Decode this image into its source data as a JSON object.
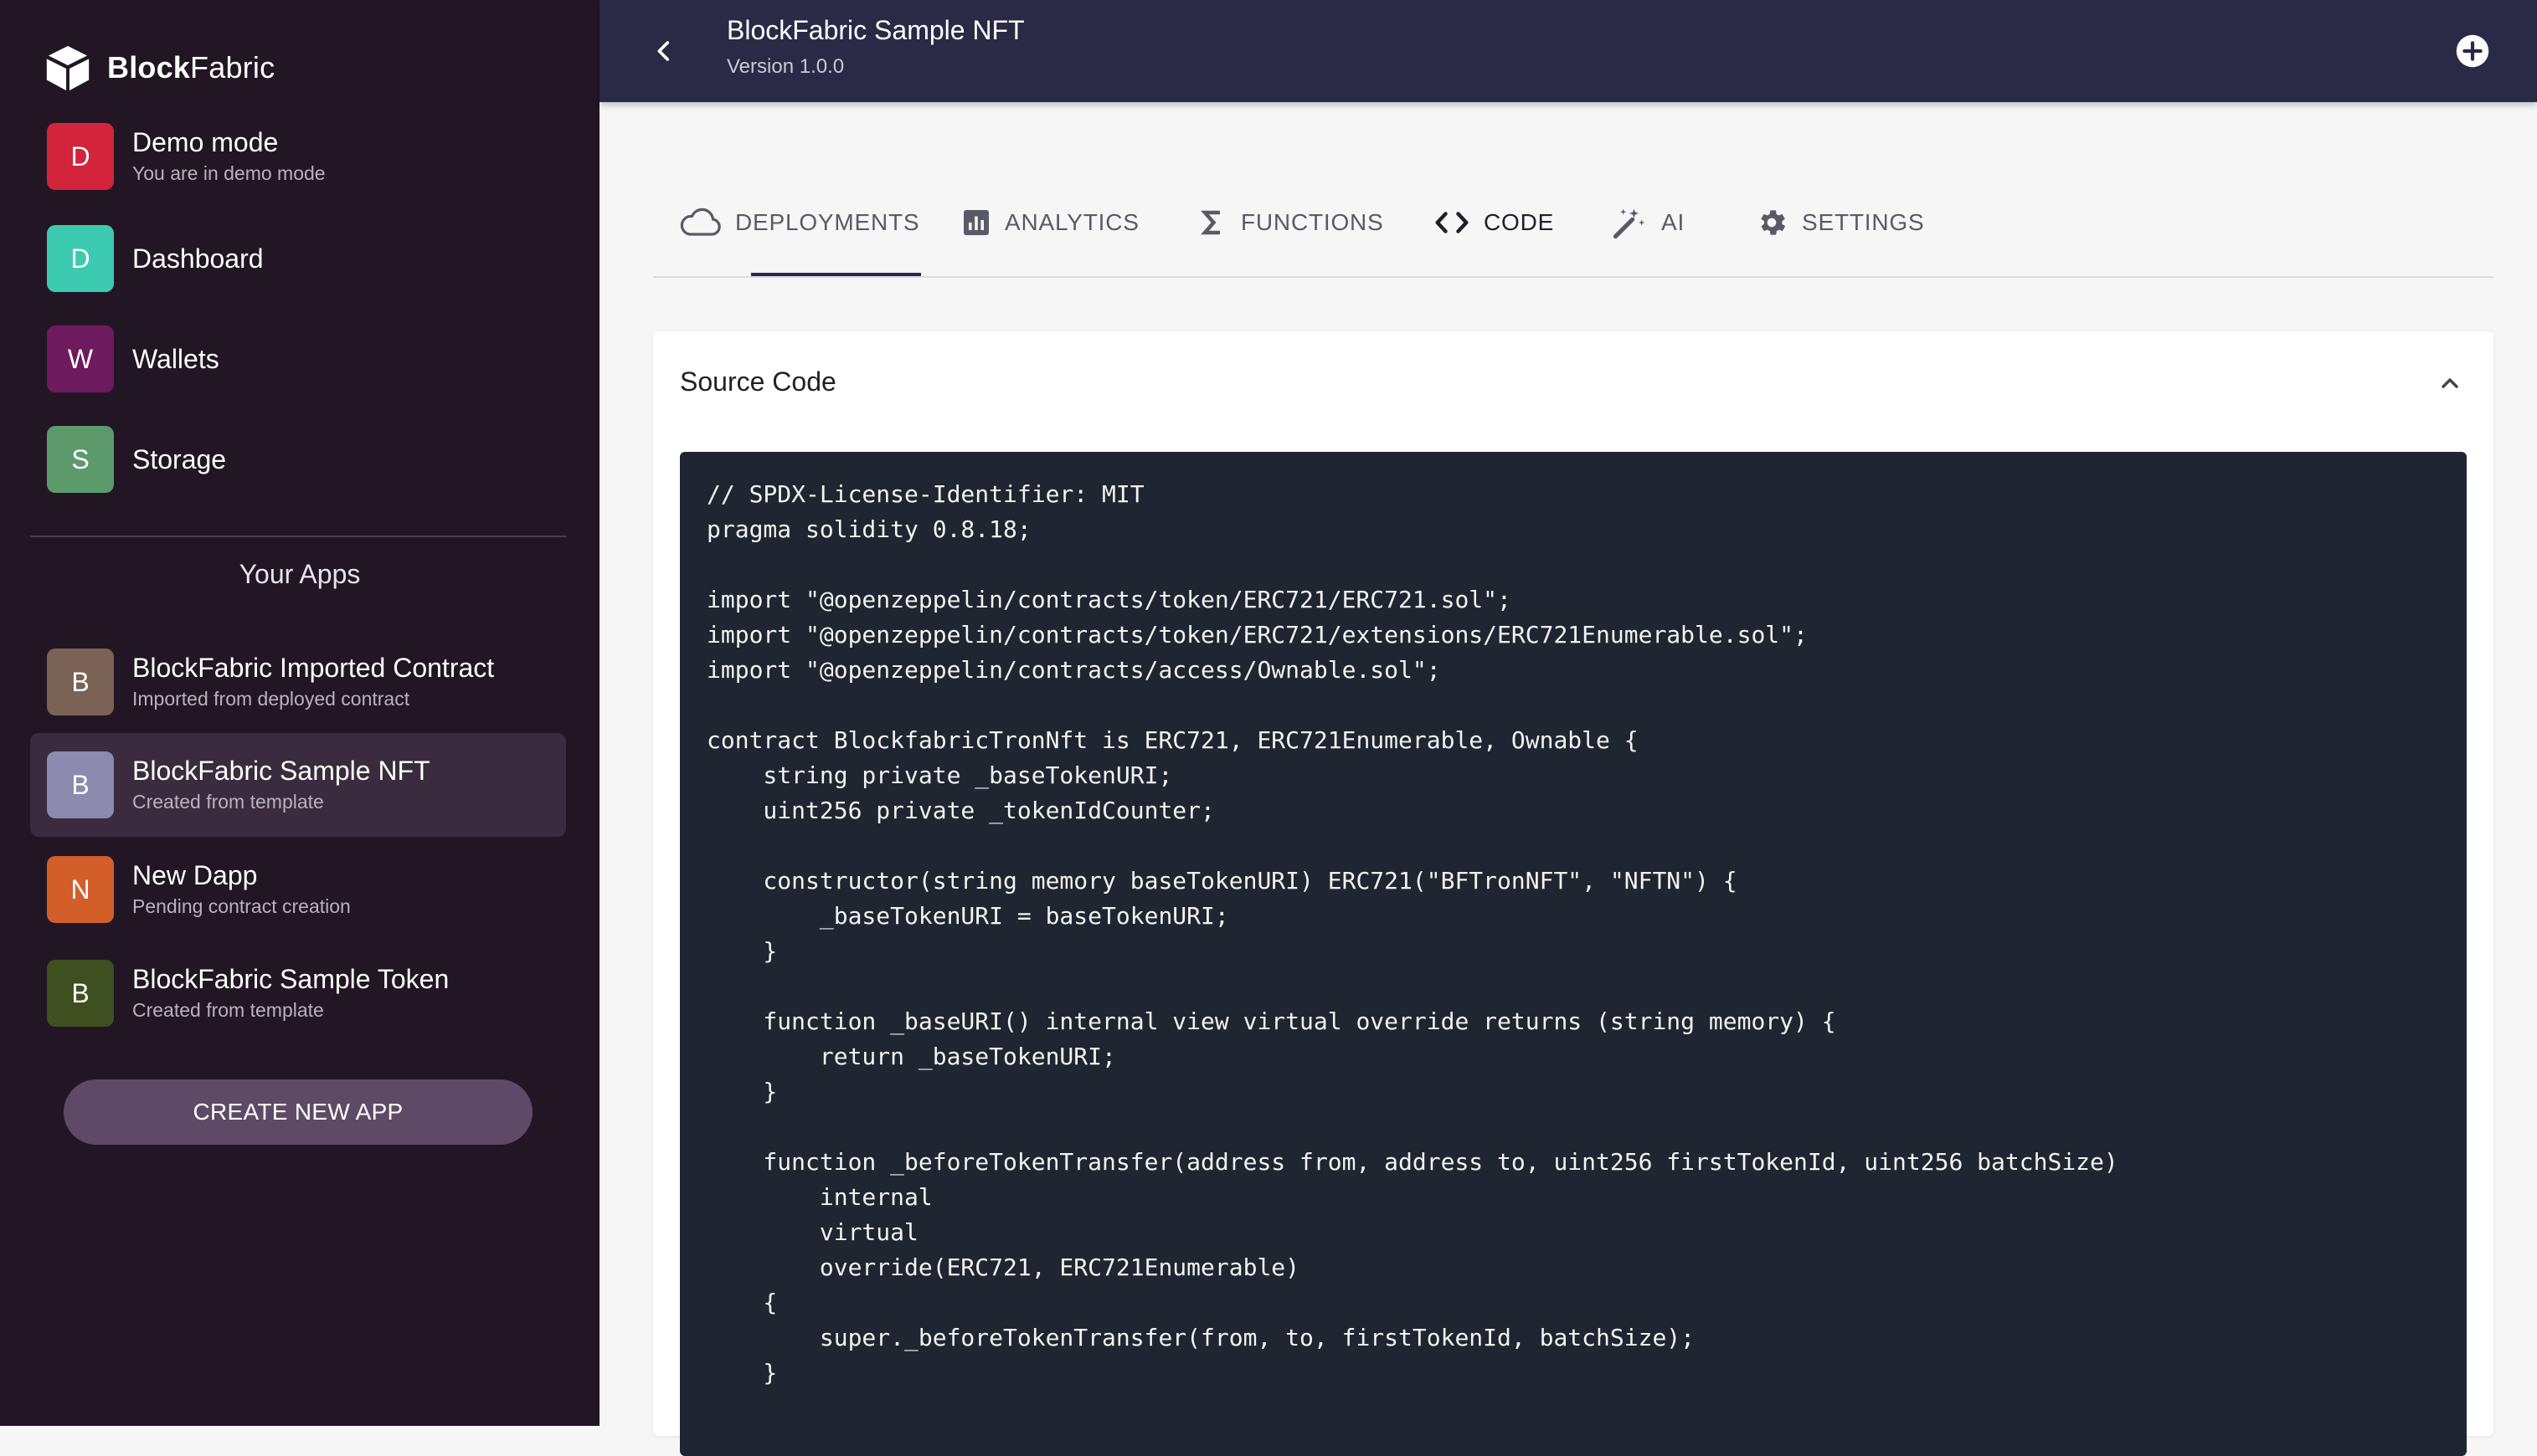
{
  "brand": {
    "name_bold": "Block",
    "name_light": "Fabric"
  },
  "sidebar": {
    "nav": [
      {
        "initial": "D",
        "title": "Demo mode",
        "subtitle": "You are in demo mode",
        "color": "#d3243b"
      },
      {
        "initial": "D",
        "title": "Dashboard",
        "subtitle": "",
        "color": "#3ccbb1"
      },
      {
        "initial": "W",
        "title": "Wallets",
        "subtitle": "",
        "color": "#6d1a5e"
      },
      {
        "initial": "S",
        "title": "Storage",
        "subtitle": "",
        "color": "#5c9a6b"
      }
    ],
    "apps_heading": "Your Apps",
    "apps": [
      {
        "initial": "B",
        "title": "BlockFabric Imported Contract",
        "subtitle": "Imported from deployed contract",
        "color": "#7a6354"
      },
      {
        "initial": "B",
        "title": "BlockFabric Sample NFT",
        "subtitle": "Created from template",
        "color": "#8c8aae",
        "selected": true
      },
      {
        "initial": "N",
        "title": "New Dapp",
        "subtitle": "Pending contract creation",
        "color": "#d45e2a"
      },
      {
        "initial": "B",
        "title": "BlockFabric Sample Token",
        "subtitle": "Created from template",
        "color": "#3f5020"
      }
    ],
    "create_button": "CREATE NEW APP"
  },
  "header": {
    "title": "BlockFabric Sample NFT",
    "version": "Version 1.0.0"
  },
  "tabs": [
    {
      "label": "DEPLOYMENTS",
      "icon": "cloud-icon"
    },
    {
      "label": "ANALYTICS",
      "icon": "analytics-icon"
    },
    {
      "label": "FUNCTIONS",
      "icon": "sigma-icon"
    },
    {
      "label": "CODE",
      "icon": "code-icon",
      "active": true
    },
    {
      "label": "AI",
      "icon": "magic-wand-icon"
    },
    {
      "label": "SETTINGS",
      "icon": "gear-icon"
    }
  ],
  "source": {
    "title": "Source Code",
    "code": "// SPDX-License-Identifier: MIT\npragma solidity 0.8.18;\n\nimport \"@openzeppelin/contracts/token/ERC721/ERC721.sol\";\nimport \"@openzeppelin/contracts/token/ERC721/extensions/ERC721Enumerable.sol\";\nimport \"@openzeppelin/contracts/access/Ownable.sol\";\n\ncontract BlockfabricTronNft is ERC721, ERC721Enumerable, Ownable {\n    string private _baseTokenURI;\n    uint256 private _tokenIdCounter;\n\n    constructor(string memory baseTokenURI) ERC721(\"BFTronNFT\", \"NFTN\") {\n        _baseTokenURI = baseTokenURI;\n    }\n\n    function _baseURI() internal view virtual override returns (string memory) {\n        return _baseTokenURI;\n    }\n\n    function _beforeTokenTransfer(address from, address to, uint256 firstTokenId, uint256 batchSize)\n        internal\n        virtual\n        override(ERC721, ERC721Enumerable)\n    {\n        super._beforeTokenTransfer(from, to, firstTokenId, batchSize);\n    }\n"
  }
}
